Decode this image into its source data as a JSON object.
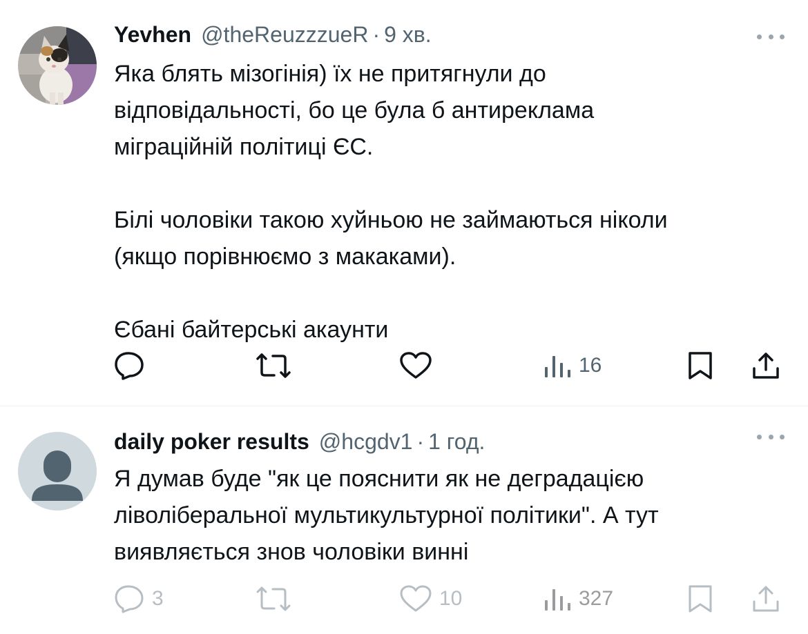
{
  "tweets": [
    {
      "author_name": "Yevhen",
      "handle": "@theReuzzzueR",
      "separator": "·",
      "time": "9 хв.",
      "avatar": "cat-photo-avatar",
      "paragraphs": [
        [
          "Яка блять мізогінія) їх не притягнули до",
          "відповідальності, бо це була б антиреклама",
          "міграційній політиці ЄС."
        ],
        [
          "Білі чоловіки такою хуйньою не займаються ніколи",
          "(якщо порівнюємо з макаками)."
        ],
        [
          "Єбані байтерські акаунти"
        ]
      ],
      "actions": {
        "reply_count": "",
        "retweet_count": "",
        "like_count": "",
        "views_count": "16"
      },
      "faded_actions": false
    },
    {
      "author_name": "daily poker results",
      "handle": "@hcgdv1",
      "separator": "·",
      "time": "1 год.",
      "avatar": "default-person-avatar",
      "paragraphs": [
        [
          "Я думав буде \"як це пояснити як не деградацією",
          "ліволіберальної мультикультурної політики\". А тут",
          "виявляється знов чоловіки винні"
        ]
      ],
      "actions": {
        "reply_count": "3",
        "retweet_count": "",
        "like_count": "10",
        "views_count": "327"
      },
      "faded_actions": true
    }
  ],
  "icons": [
    "more-icon",
    "reply-icon",
    "retweet-icon",
    "like-icon",
    "views-icon",
    "bookmark-icon",
    "share-icon"
  ],
  "colors": {
    "text": "#0f1419",
    "secondary": "#536471",
    "divider": "#eff3f4",
    "default_avatar_bg": "#cfd9de",
    "default_avatar_fg": "#536471"
  }
}
